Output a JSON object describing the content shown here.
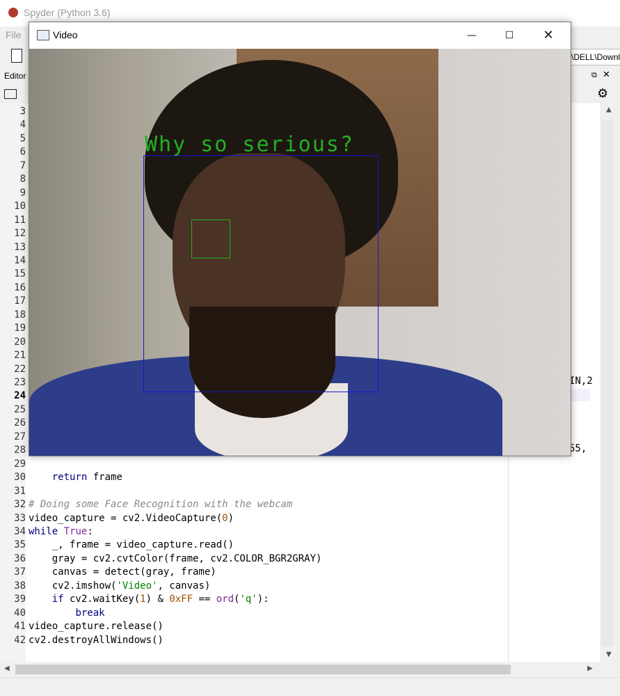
{
  "app": {
    "title": "Spyder (Python 3.6)"
  },
  "menubar": {
    "file_label": "File"
  },
  "toolbar": {
    "path_text": "\\DELL\\Downlo"
  },
  "pane": {
    "tab_label": "Editor",
    "undock_glyph": "⧉",
    "close_glyph": "✕"
  },
  "editor": {
    "current_line": 24,
    "line_numbers": [
      "3",
      "4",
      "5",
      "6",
      "7",
      "8",
      "9",
      "10",
      "11",
      "12",
      "13",
      "14",
      "15",
      "16",
      "17",
      "18",
      "19",
      "20",
      "21",
      "22",
      "23",
      "24",
      "25",
      "26",
      "27",
      "28",
      "29",
      "30",
      "31",
      "32",
      "33",
      "34",
      "35",
      "36",
      "37",
      "38",
      "39",
      "40",
      "41",
      "42"
    ],
    "code_lines": [
      {
        "n": 30,
        "text": "    return frame"
      },
      {
        "n": 31,
        "text": ""
      },
      {
        "n": 32,
        "text": "# Doing some Face Recognition with the webcam"
      },
      {
        "n": 33,
        "text": "video_capture = cv2.VideoCapture(0)"
      },
      {
        "n": 34,
        "text": "while True:"
      },
      {
        "n": 35,
        "text": "    _, frame = video_capture.read()"
      },
      {
        "n": 36,
        "text": "    gray = cv2.cvtColor(frame, cv2.COLOR_BGR2GRAY)"
      },
      {
        "n": 37,
        "text": "    canvas = detect(gray, frame)"
      },
      {
        "n": 38,
        "text": "    cv2.imshow('Video', canvas)"
      },
      {
        "n": 39,
        "text": "    if cv2.waitKey(1) & 0xFF == ord('q'):"
      },
      {
        "n": 40,
        "text": "        break"
      },
      {
        "n": 41,
        "text": "video_capture.release()"
      },
      {
        "n": 42,
        "text": "cv2.destroyAllWindows()"
      }
    ],
    "right_fragments": {
      "line23": "IN,2",
      "line28": "55,"
    }
  },
  "video_window": {
    "title": "Video",
    "minimize_glyph": "—",
    "maximize_glyph": "☐",
    "close_glyph": "✕",
    "caption": "Why so serious?",
    "colors": {
      "caption": "#22b022",
      "face_box": "#1515d0",
      "eye_box": "#22b022"
    }
  },
  "icons": [
    "spyder-icon",
    "new-file-icon",
    "open-folder-icon",
    "gear-icon",
    "video-window-icon",
    "undock-icon",
    "close-icon"
  ]
}
